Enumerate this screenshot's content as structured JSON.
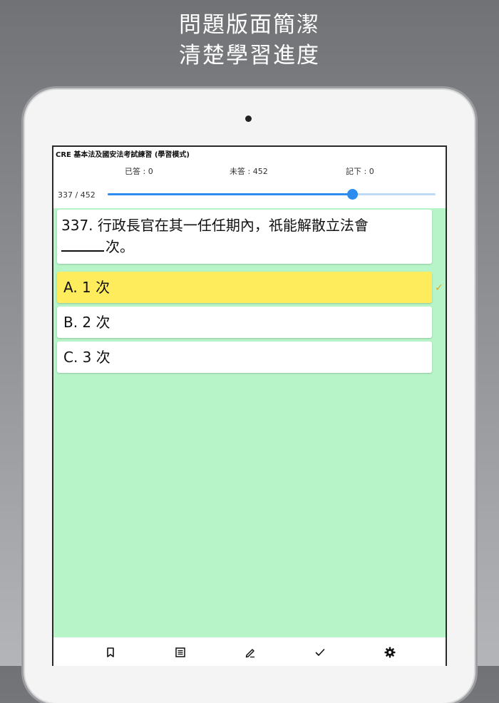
{
  "headline": {
    "line1": "問題版面簡潔",
    "line2": "清楚學習進度"
  },
  "app": {
    "title": "CRE 基本法及國安法考試練習 (學習模式)",
    "stats": {
      "answered": "已答 : 0",
      "unanswered": "未答 : 452",
      "noted": "記下 : 0"
    },
    "progress_label": "337 / 452",
    "progress_fraction": 0.745
  },
  "question": {
    "text_before": "337. 行政長官在其一任任期內，祇能解散立法會",
    "text_after": "次。"
  },
  "options": [
    {
      "label": "A. 1 次",
      "selected": true
    },
    {
      "label": "B. 2 次",
      "selected": false
    },
    {
      "label": "C. 3 次",
      "selected": false
    }
  ],
  "colors": {
    "screen_background": "#b7f5c8",
    "selected_option": "#ffec5c",
    "accent": "#2d8cf0",
    "check_mark": "#e6a817"
  },
  "toolbar_icons": [
    "bookmark-icon",
    "list-icon",
    "pen-icon",
    "check-icon",
    "gear-icon"
  ]
}
